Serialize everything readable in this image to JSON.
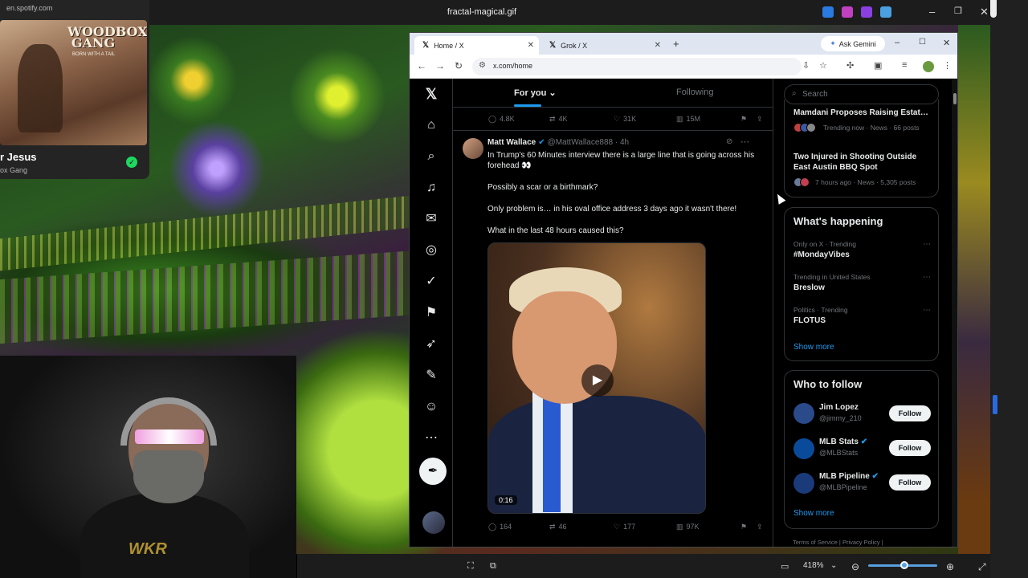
{
  "viewer": {
    "title": "fractal-magical.gif",
    "zoom": "418%",
    "minimize_icon": "minimize-icon",
    "maximize_icon": "maximize-icon",
    "close_icon": "close-icon"
  },
  "spotify": {
    "url": "en.spotify.com",
    "album_art_title": "WOODBOX GANG",
    "album_art_sub": "BORN WITH A TAIL",
    "track_title": "r Jesus",
    "track_artist": "ox Gang"
  },
  "webcam": {
    "shirt_text": "WKR"
  },
  "browser": {
    "tabs": [
      {
        "label": "Home / X",
        "active": true
      },
      {
        "label": "Grok / X",
        "active": false
      }
    ],
    "ask_gemini": "Ask Gemini",
    "url": "x.com/home"
  },
  "x": {
    "feed_tabs": {
      "for_you": "For you",
      "following": "Following"
    },
    "top_actions": {
      "replies": "4.8K",
      "reposts": "4K",
      "likes": "31K",
      "views": "15M"
    },
    "post": {
      "author": "Matt Wallace",
      "handle": "@MattWallace888 · 4h",
      "lines": [
        "In Trump's 60 Minutes interview there is a large line that is going across his forehead 👀",
        "Possibly a scar or a birthmark?",
        "Only problem is… in his oval office address 3 days ago it wasn't there!",
        "What in the last 48 hours caused this?"
      ],
      "video_time": "0:16",
      "actions": {
        "replies": "164",
        "reposts": "46",
        "likes": "177",
        "views": "97K"
      }
    },
    "search_placeholder": "Search",
    "news": [
      {
        "title": "Mamdani Proposes Raising Estat…",
        "meta": "Trending now · News · 66 posts"
      },
      {
        "title": "Two Injured in Shooting Outside East Austin BBQ Spot",
        "meta": "7 hours ago · News · 5,305 posts"
      }
    ],
    "happening": {
      "heading": "What's happening",
      "items": [
        {
          "meta": "Only on X · Trending",
          "name": "#MondayVibes"
        },
        {
          "meta": "Trending in United States",
          "name": "Breslow"
        },
        {
          "meta": "Politics · Trending",
          "name": "FLOTUS"
        }
      ],
      "show_more": "Show more"
    },
    "who_to_follow": {
      "heading": "Who to follow",
      "items": [
        {
          "name": "Jim Lopez",
          "handle": "@jimmy_210",
          "button": "Follow",
          "verified": false
        },
        {
          "name": "MLB Stats",
          "handle": "@MLBStats",
          "button": "Follow",
          "verified": true
        },
        {
          "name": "MLB Pipeline",
          "handle": "@MLBPipeline",
          "button": "Follow",
          "verified": true
        }
      ],
      "show_more": "Show more"
    },
    "footer": "Terms of Service  |  Privacy Policy  |"
  },
  "colors": {
    "x_blue": "#1d9bf0",
    "x_bg": "#000000",
    "spotify_green": "#1ed760"
  }
}
